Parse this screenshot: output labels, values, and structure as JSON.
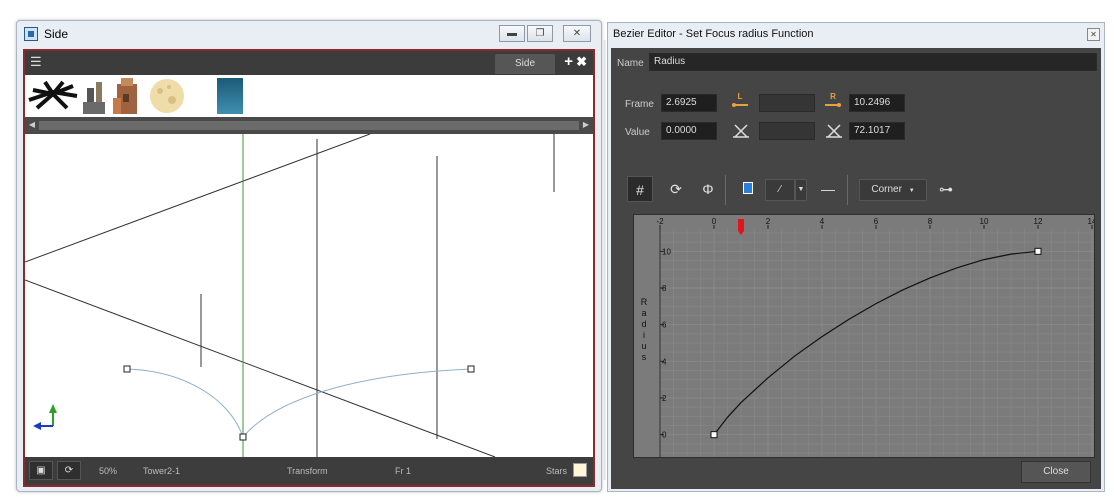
{
  "side_window": {
    "title": "Side",
    "tab_label": "Side",
    "status": {
      "zoom": "50%",
      "layer": "Tower2-1",
      "tool": "Transform",
      "frame": "Fr 1",
      "palette": "Stars"
    },
    "icons": [
      "app-icon",
      "minimize-icon",
      "restore-icon",
      "close-icon",
      "menu-icon",
      "add-view-icon",
      "close-view-icon",
      "camera-icon",
      "rotate-icon",
      "axis-gizmo-icon"
    ]
  },
  "bezier_editor": {
    "title": "Bezier Editor - Set Focus radius Function",
    "name_label": "Name",
    "name_value": "Radius",
    "frame_label": "Frame",
    "frame_value": "2.6925",
    "left_handle_icon_text": "L",
    "right_handle_icon_text": "R",
    "right_frame_value": "10.2496",
    "value_label": "Value",
    "value_value": "0.0000",
    "right_angle_value": "72.1017",
    "interpolation": "Corner",
    "close_label": "Close"
  },
  "chart_data": {
    "type": "line",
    "xlabel": "",
    "ylabel": "Radius",
    "xlim": [
      -2,
      14
    ],
    "ylim": [
      -1,
      11
    ],
    "x_ticks": [
      -2,
      0,
      2,
      4,
      6,
      8,
      10,
      12,
      14
    ],
    "y_ticks": [
      0,
      2,
      4,
      6,
      8,
      10
    ],
    "current_frame": 1,
    "keyframes": [
      {
        "x": 0,
        "y": 0
      },
      {
        "x": 12,
        "y": 10
      }
    ],
    "series": [
      {
        "values": [
          [
            0,
            0
          ],
          [
            0.5,
            0.95
          ],
          [
            1,
            1.75
          ],
          [
            2,
            3.1
          ],
          [
            3,
            4.3
          ],
          [
            4,
            5.35
          ],
          [
            5,
            6.3
          ],
          [
            6,
            7.15
          ],
          [
            7,
            7.9
          ],
          [
            8,
            8.55
          ],
          [
            9,
            9.1
          ],
          [
            10,
            9.55
          ],
          [
            11,
            9.85
          ],
          [
            12,
            10
          ]
        ]
      }
    ],
    "grid": true,
    "colors": {
      "curve": "#111111",
      "background": "#7b7b7b",
      "frame_marker": "#e0141a"
    }
  }
}
